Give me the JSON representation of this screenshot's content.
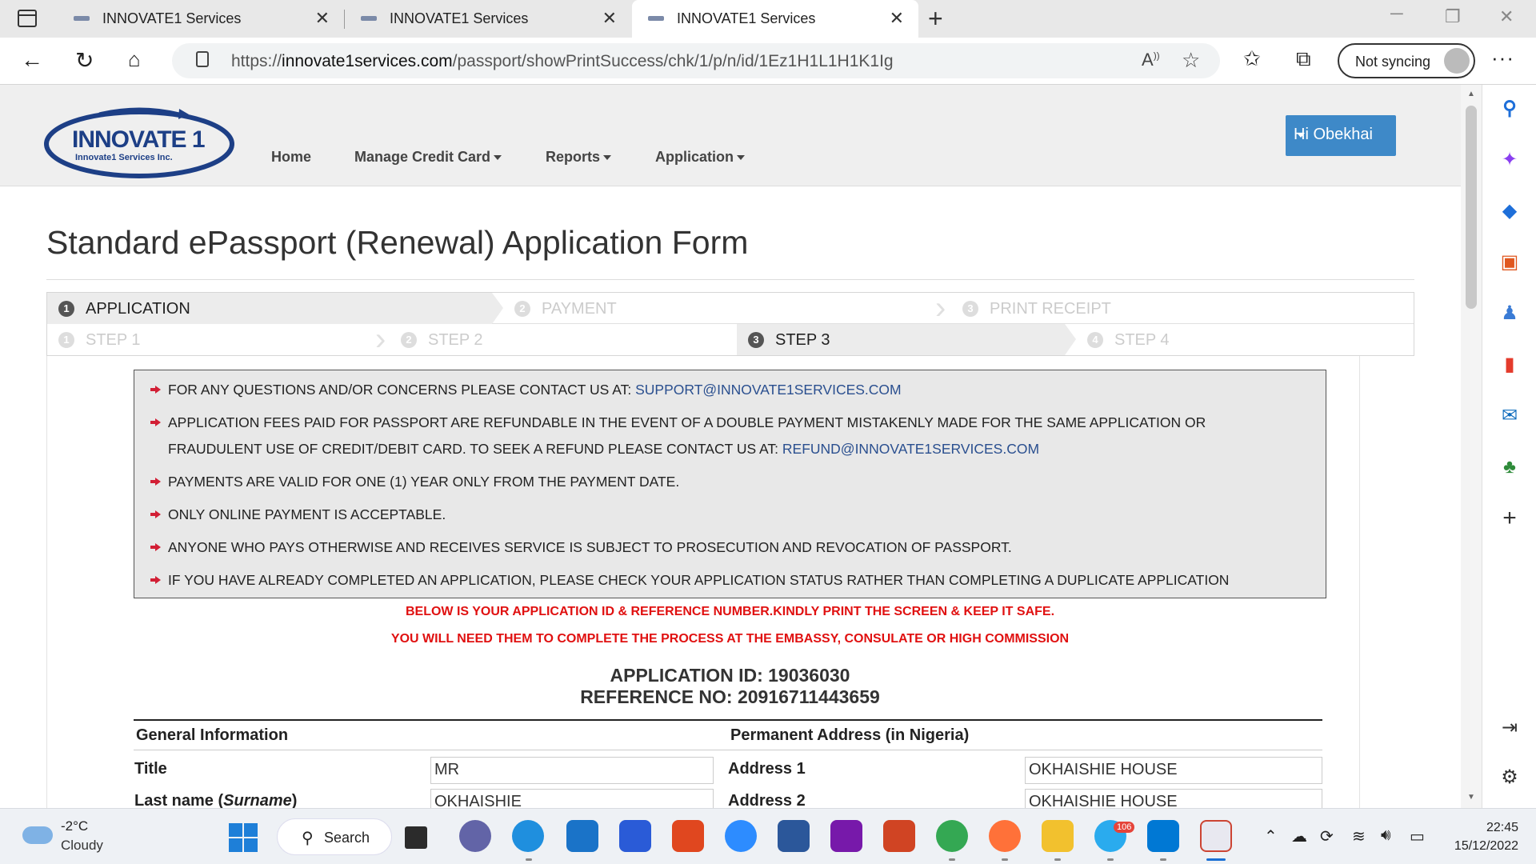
{
  "browser": {
    "tabs": [
      {
        "title": "INNOVATE1 Services",
        "active": false
      },
      {
        "title": "INNOVATE1 Services",
        "active": false
      },
      {
        "title": "INNOVATE1 Services",
        "active": true
      }
    ],
    "url_prefix": "https://",
    "url_domain": "innovate1services.com",
    "url_path": "/passport/showPrintSuccess/chk/1/p/n/id/1Ez1H1L1H1K1Ig",
    "sync_label": "Not syncing"
  },
  "site": {
    "logo_main": "INNOVATE 1",
    "logo_sub": "Innovate1 Services Inc.",
    "menu": {
      "home": "Home",
      "credit_card": "Manage Credit Card",
      "reports": "Reports",
      "application": "Application"
    },
    "user_greeting": "Hi Obekhai"
  },
  "page": {
    "title": "Standard ePassport (Renewal) Application Form",
    "wizard_top": [
      {
        "num": "1",
        "label": "APPLICATION",
        "active": true
      },
      {
        "num": "2",
        "label": "PAYMENT",
        "active": false
      },
      {
        "num": "3",
        "label": "PRINT RECEIPT",
        "active": false
      }
    ],
    "wizard_bottom": [
      {
        "num": "1",
        "label": "STEP 1",
        "active": false
      },
      {
        "num": "2",
        "label": "STEP 2",
        "active": false
      },
      {
        "num": "3",
        "label": "STEP 3",
        "active": true
      },
      {
        "num": "4",
        "label": "STEP 4",
        "active": false
      }
    ],
    "notices": {
      "n1_text": "FOR ANY QUESTIONS AND/OR CONCERNS PLEASE CONTACT US AT: ",
      "n1_link": "SUPPORT@INNOVATE1SERVICES.COM",
      "n2_line1": "APPLICATION FEES PAID FOR PASSPORT ARE REFUNDABLE IN THE EVENT OF A DOUBLE PAYMENT MISTAKENLY MADE FOR THE SAME APPLICATION OR",
      "n2_line2": "FRAUDULENT USE OF CREDIT/DEBIT CARD. TO SEEK A REFUND PLEASE CONTACT US AT: ",
      "n2_link": "REFUND@INNOVATE1SERVICES.COM",
      "n3": "PAYMENTS ARE VALID FOR ONE (1) YEAR ONLY FROM THE PAYMENT DATE.",
      "n4": "ONLY ONLINE PAYMENT IS ACCEPTABLE.",
      "n5": "ANYONE WHO PAYS OTHERWISE AND RECEIVES SERVICE IS SUBJECT TO PROSECUTION AND REVOCATION OF PASSPORT.",
      "n6": "IF YOU HAVE ALREADY COMPLETED AN APPLICATION, PLEASE CHECK YOUR APPLICATION STATUS RATHER THAN COMPLETING A DUPLICATE APPLICATION"
    },
    "warning1": "BELOW IS YOUR APPLICATION ID & REFERENCE NUMBER.KINDLY PRINT THE SCREEN & KEEP IT SAFE.",
    "warning2": "YOU WILL NEED THEM TO COMPLETE THE PROCESS AT THE EMBASSY, CONSULATE OR HIGH COMMISSION",
    "application_id": "APPLICATION ID: 19036030",
    "reference_no": "REFERENCE NO: 20916711443659",
    "general_info_head": "General Information",
    "address_head": "Permanent Address (in Nigeria)",
    "fields": {
      "title_label": "Title",
      "title_value": "MR",
      "lastname_label": "Last name (",
      "lastname_label_em": "Surname",
      "lastname_label_end": ")",
      "lastname_value": "OKHAISHIE",
      "address1_label": "Address 1",
      "address1_value": "OKHAISHIE HOUSE",
      "address2_label": "Address 2",
      "address2_value": "OKHAISHIE HOUSE"
    }
  },
  "taskbar": {
    "temp": "-2°C",
    "weather": "Cloudy",
    "search": "Search",
    "badge": "106",
    "time": "22:45",
    "date": "15/12/2022"
  }
}
